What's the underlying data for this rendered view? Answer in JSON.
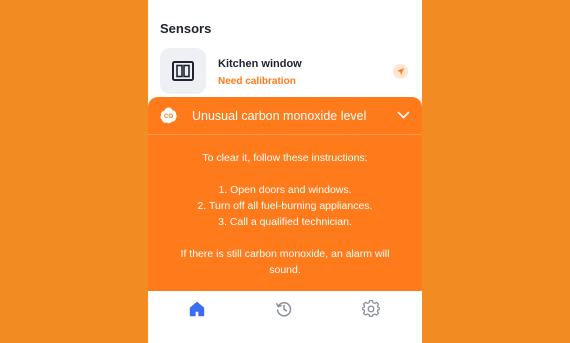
{
  "sensors": {
    "title": "Sensors",
    "items": [
      {
        "name": "Kitchen window",
        "status": "Need calibration",
        "icon": "window-icon"
      }
    ]
  },
  "alert": {
    "badge": "CO",
    "title": "Unusual carbon monoxide level",
    "intro": "To clear it, follow these instructions:",
    "steps": [
      "1. Open doors and windows.",
      "2. Turn off all fuel-burning appliances.",
      "3. Call a qualified technician."
    ],
    "footer": "If there is still carbon monoxide, an alarm will sound."
  },
  "nav": {
    "items": [
      {
        "icon": "home-icon",
        "active": true
      },
      {
        "icon": "history-icon",
        "active": false
      },
      {
        "icon": "settings-icon",
        "active": false
      }
    ]
  },
  "colors": {
    "background": "#f28c22",
    "alert": "#ff7a1a",
    "accent": "#3b6ff2",
    "text": "#1f2230"
  }
}
